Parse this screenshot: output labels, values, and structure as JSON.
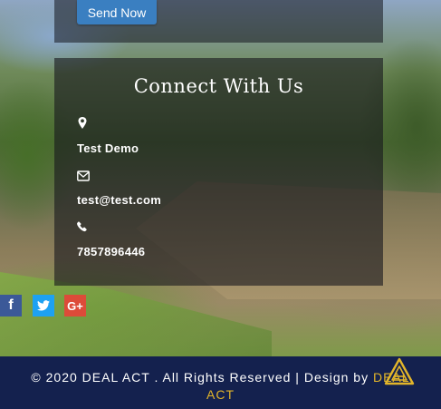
{
  "form": {
    "send_label": "Send Now"
  },
  "connect": {
    "title": "Connect With Us",
    "items": [
      {
        "icon": "map-marker-icon",
        "text": "Test Demo"
      },
      {
        "icon": "envelope-icon",
        "text": "test@test.com"
      },
      {
        "icon": "phone-icon",
        "text": "7857896446"
      }
    ]
  },
  "social": [
    {
      "icon": "facebook-icon",
      "glyph": "f"
    },
    {
      "icon": "twitter-icon",
      "glyph": "🐦"
    },
    {
      "icon": "google-plus-icon",
      "glyph": "G+"
    }
  ],
  "footer": {
    "copyright": "© 2020 DEAL ACT . All Rights Reserved | Design by ",
    "designer_line1": "DEAL",
    "designer_line2": "ACT"
  },
  "colors": {
    "button": "#3a7fc1",
    "footer_bg": "#14214e",
    "brand_gold": "#e2b52a",
    "facebook": "#3b5998",
    "twitter": "#1da1f2",
    "google_plus": "#dd4b39"
  }
}
